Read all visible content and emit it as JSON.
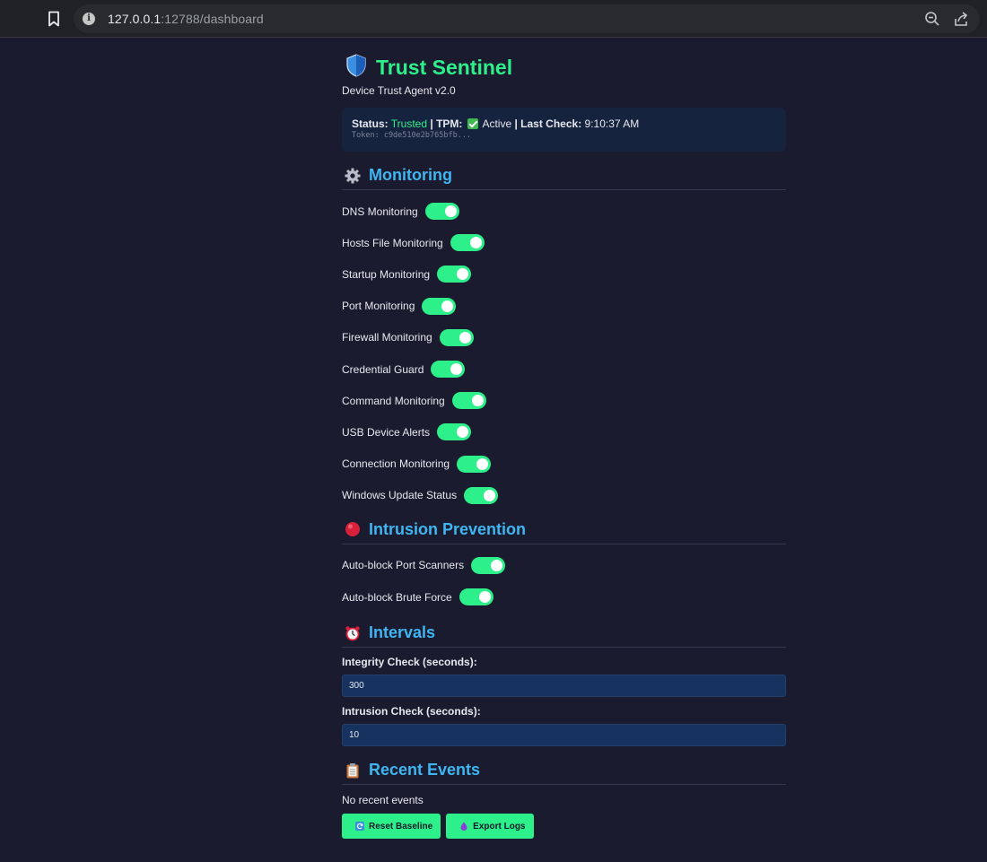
{
  "browser": {
    "url_host": "127.0.0.1",
    "url_rest": ":12788/dashboard"
  },
  "header": {
    "title": "Trust Sentinel",
    "subtitle": "Device Trust Agent v2.0"
  },
  "status": {
    "status_label": "Status:",
    "status_value": "Trusted",
    "tpm_label": "TPM:",
    "tpm_value": "Active",
    "last_check_label": "Last Check:",
    "last_check_value": "9:10:37 AM",
    "separator": "|",
    "token": "Token: c9de510e2b765bfb..."
  },
  "monitoring": {
    "title": "Monitoring",
    "toggles": [
      {
        "label": "DNS Monitoring",
        "enabled": true
      },
      {
        "label": "Hosts File Monitoring",
        "enabled": true
      },
      {
        "label": "Startup Monitoring",
        "enabled": true
      },
      {
        "label": "Port Monitoring",
        "enabled": true
      },
      {
        "label": "Firewall Monitoring",
        "enabled": true
      },
      {
        "label": "Credential Guard",
        "enabled": true
      },
      {
        "label": "Command Monitoring",
        "enabled": true
      },
      {
        "label": "USB Device Alerts",
        "enabled": true
      },
      {
        "label": "Connection Monitoring",
        "enabled": true
      },
      {
        "label": "Windows Update Status",
        "enabled": true
      }
    ]
  },
  "intrusion": {
    "title": "Intrusion Prevention",
    "toggles": [
      {
        "label": "Auto-block Port Scanners",
        "enabled": true
      },
      {
        "label": "Auto-block Brute Force",
        "enabled": true
      }
    ]
  },
  "intervals": {
    "title": "Intervals",
    "integrity_label": "Integrity Check (seconds):",
    "integrity_value": "300",
    "intrusion_label": "Intrusion Check (seconds):",
    "intrusion_value": "10"
  },
  "events": {
    "title": "Recent Events",
    "empty_text": "No recent events",
    "reset_label": "Reset Baseline",
    "export_label": "Export Logs"
  },
  "colors": {
    "accent_green": "#2ef08a",
    "section_blue": "#3fb6f2",
    "background": "#1a1b2e",
    "card": "#16233f"
  },
  "icons": {
    "title": "shield-icon",
    "monitoring": "gear-icon",
    "intrusion": "red-circle-icon",
    "intervals": "alarm-clock-icon",
    "events": "clipboard-icon",
    "reset": "refresh-icon",
    "export": "droplet-icon"
  }
}
